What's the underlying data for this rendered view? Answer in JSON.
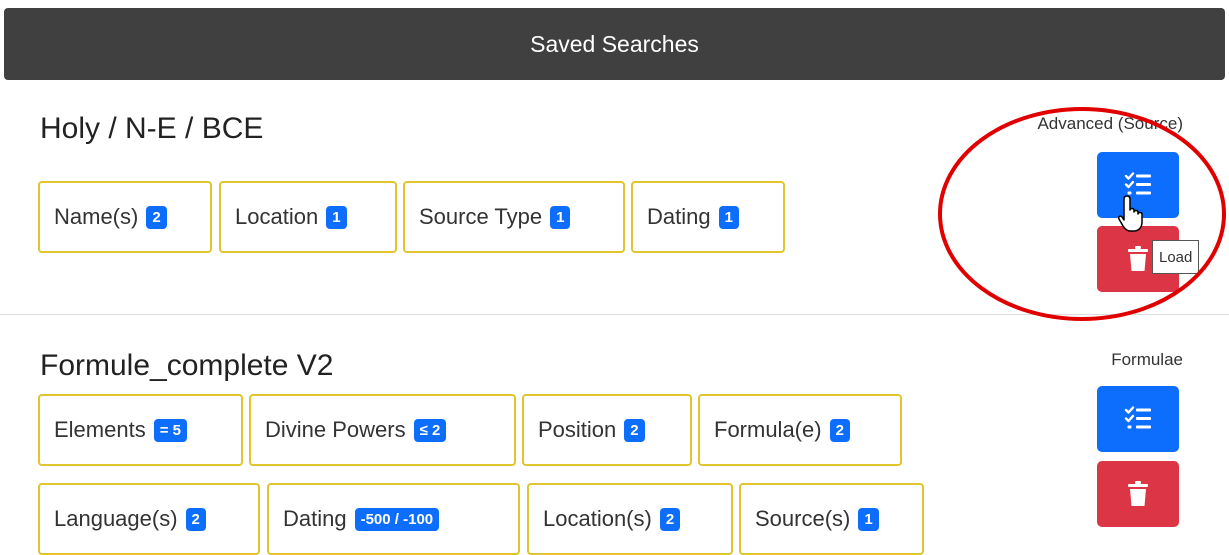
{
  "header": {
    "title": "Saved Searches"
  },
  "searches": [
    {
      "title": "Holy / N-E / BCE",
      "type_label": "Advanced (Source)",
      "filters": [
        {
          "label": "Name(s)",
          "badge": "2"
        },
        {
          "label": "Location",
          "badge": "1"
        },
        {
          "label": "Source Type",
          "badge": "1"
        },
        {
          "label": "Dating",
          "badge": "1"
        }
      ],
      "actions": {
        "load_icon": "list-check-icon",
        "delete_icon": "trash-icon"
      }
    },
    {
      "title": "Formule_complete V2",
      "type_label": "Formulae",
      "filters": [
        {
          "label": "Elements",
          "badge": "= 5"
        },
        {
          "label": "Divine Powers",
          "badge": "≤ 2"
        },
        {
          "label": "Position",
          "badge": "2"
        },
        {
          "label": "Formula(e)",
          "badge": "2"
        },
        {
          "label": "Language(s)",
          "badge": "2"
        },
        {
          "label": "Dating",
          "badge": "-500 / -100"
        },
        {
          "label": "Location(s)",
          "badge": "2"
        },
        {
          "label": "Source(s)",
          "badge": "1"
        }
      ],
      "actions": {
        "load_icon": "list-check-icon",
        "delete_icon": "trash-icon"
      }
    }
  ],
  "tooltip": {
    "text": "Load"
  },
  "colors": {
    "header_bg": "#404040",
    "chip_border": "#e0c52e",
    "badge": "#0d6efd",
    "load_button": "#0d6efd",
    "delete_button": "#dc3545",
    "annotation": "#e00000"
  }
}
